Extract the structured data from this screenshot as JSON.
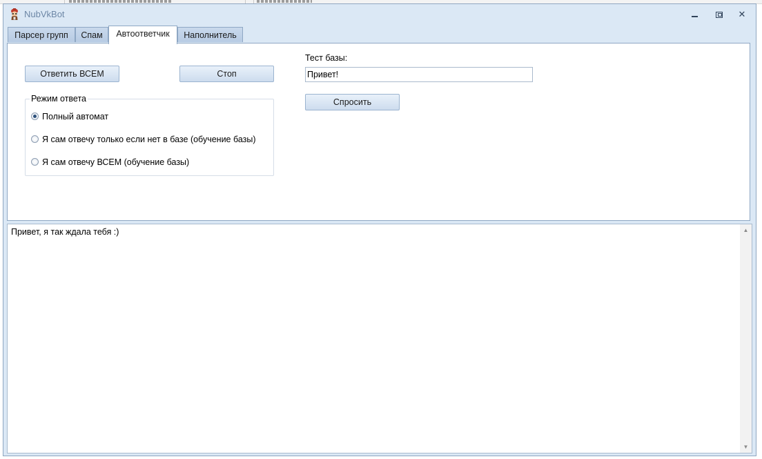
{
  "window": {
    "title": "NubVkBot",
    "icon": "bot-avatar-icon",
    "controls": {
      "minimize": "minimize-icon",
      "maximize": "maximize-icon",
      "close": "✕"
    }
  },
  "tabs": [
    {
      "label": "Парсер групп",
      "active": false
    },
    {
      "label": "Спам",
      "active": false
    },
    {
      "label": "Автоответчик",
      "active": true
    },
    {
      "label": "Наполнитель",
      "active": false
    }
  ],
  "autoresponder": {
    "answer_all_button": "Ответить ВСЕМ",
    "stop_button": "Стоп",
    "mode_group": {
      "legend": "Режим ответа",
      "options": [
        {
          "label": "Полный автомат",
          "checked": true
        },
        {
          "label": "Я сам отвечу только если нет в базе (обучение базы)",
          "checked": false
        },
        {
          "label": "Я сам отвечу ВСЕМ (обучение базы)",
          "checked": false
        }
      ]
    },
    "test_db": {
      "label": "Тест базы:",
      "input_value": "Привет!",
      "ask_button": "Спросить"
    }
  },
  "output": {
    "text": "Привет, я так ждала тебя :)",
    "scroll_up": "▲",
    "scroll_down": "▼"
  },
  "colors": {
    "window_frame": "#dbe8f5",
    "title_text": "#6d87a6",
    "button_gradient_top": "#e9f1fa",
    "button_gradient_bottom": "#cddcee",
    "tab_inactive": "#c9d9ec"
  }
}
